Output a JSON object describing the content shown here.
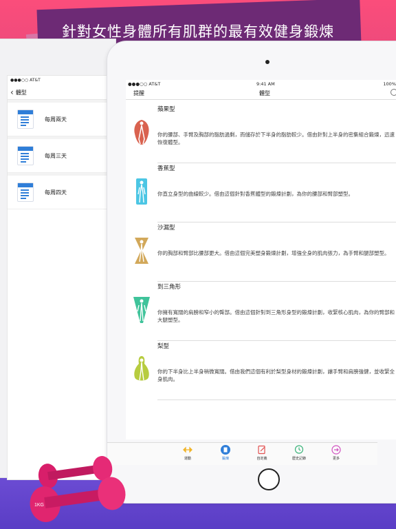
{
  "headline": "針對女性身體所有肌群的最有效健身鍛煉",
  "back_screen": {
    "status": "●●●○○ AT&T",
    "nav_title": "體型",
    "items": [
      {
        "label": "每周兩天",
        "icon": "document-list-icon"
      },
      {
        "label": "每周三天",
        "icon": "document-list-icon"
      },
      {
        "label": "每周四天",
        "icon": "document-list-icon"
      }
    ]
  },
  "front_screen": {
    "status": {
      "carrier": "●●●○○ AT&T",
      "time": "9:41 AM",
      "battery": "100%"
    },
    "nav_left": "提醒",
    "nav_title": "體型",
    "entries": [
      {
        "title": "蘋果型",
        "desc": "你的腰部、手臂及胸部的脂肪過剩，而儲存於下半身的脂肪較少。借由針對上半身的密集組合鍛煉，迅速恢復體型。",
        "icon": "apple-body-icon",
        "color": "#d9624f"
      },
      {
        "title": "香蕉型",
        "desc": "你直立身型的曲線較少。借由這個針對香蕉體型的鍛煉計劃，為你的腰部和臂部塑型。",
        "icon": "banana-body-icon",
        "color": "#4cc6e4"
      },
      {
        "title": "沙漏型",
        "desc": "你的胸部和臂部比腰部更大。借由這個完美塑身鍛煉計劃，增強全身的肌肉張力，為手臂和腿部塑型。",
        "icon": "hourglass-body-icon",
        "color": "#d2a85a"
      },
      {
        "title": "到三角形",
        "desc": "你擁有寬闊的肩膀和窄小的臀部。借由這個針對到三角形身型的鍛煉計劃，收緊核心肌肉，為你的臂部和大腿塑型。",
        "icon": "inverted-triangle-body-icon",
        "color": "#3fc39a"
      },
      {
        "title": "梨型",
        "desc": "你的下半身比上半身稍微寬闊。借由我們這個有利於梨型身材的鍛煉計劃，讓手臂和肩膀強健，並收緊全身肌肉。",
        "icon": "pear-body-icon",
        "color": "#b7cc3f"
      }
    ],
    "tabs": [
      {
        "label": "運動",
        "icon": "exercise-icon",
        "color": "#f0b429"
      },
      {
        "label": "鍛煉",
        "icon": "workout-icon",
        "color": "#2f7ed8"
      },
      {
        "label": "自定義",
        "icon": "custom-icon",
        "color": "#e25050"
      },
      {
        "label": "歷史記錄",
        "icon": "history-icon",
        "color": "#3bb37a"
      },
      {
        "label": "更多",
        "icon": "more-icon",
        "color": "#d050c0"
      }
    ]
  },
  "dumbbell_label": "1KG"
}
